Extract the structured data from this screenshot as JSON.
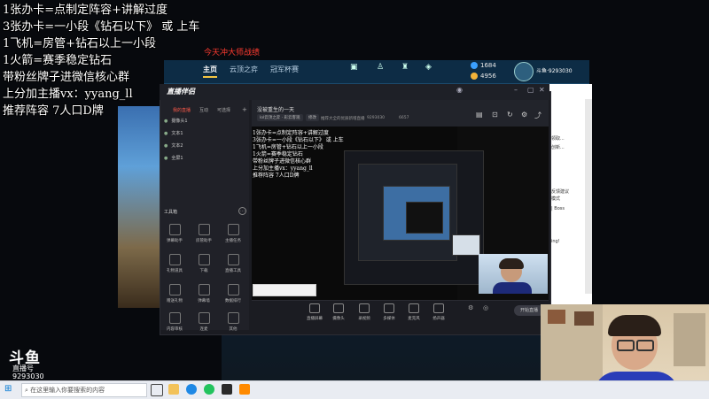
{
  "overlay": {
    "lines": [
      "1张办卡=点制定阵容+讲解过度",
      "3张办卡=一小段《钻石以下》 或 上车",
      "1飞机=房管+钻石以上一小段",
      "1火箭=赛季稳定钻石",
      "带粉丝牌子进微信核心群",
      "上分加主播vx：yyang_ll",
      "推荐阵容  7人口D牌"
    ],
    "red_title": "今天冲大师战绩"
  },
  "game": {
    "tabs": [
      "主页",
      "云顶之弈",
      "冠军杯赛"
    ],
    "active_tab": "主页",
    "currency1": "1684",
    "currency2": "4956",
    "user": "斗鱼·9293030"
  },
  "obs": {
    "app_name": "直播伴侣",
    "left_tabs": [
      "我的直播",
      "互动",
      "可选择"
    ],
    "scenes": [
      "摄像头1",
      "文本1",
      "文本2",
      "全屏1"
    ],
    "tools_title": "工具箱",
    "tools": [
      "弹幕助手",
      "房管助手",
      "主播任务",
      "礼物道具",
      "下载",
      "直播工具",
      "赠送礼物",
      "弹幕墙",
      "数据排行",
      "内容审核",
      "连麦",
      "其他"
    ],
    "preview_title": "没被重生的一天",
    "preview_chips": [
      "lol云顶之弈 · 彩云客观",
      "修改"
    ],
    "preview_sub": "推荐大全的优质新增直播",
    "room_id": "9293030",
    "viewers": "6657",
    "bottom_tools": [
      "直播屏幕",
      "摄像头",
      "录视频",
      "多媒体",
      "麦克风",
      "扬声器"
    ],
    "go_live": "开始直播"
  },
  "mini_text": [
    "1张办卡=点制定阵容+讲解过度",
    "3张办卡=一小段《钻石以下》 或 上车",
    "1飞机=房管+钻石以上一小段",
    "1火箭=赛季稳定钻石",
    "带粉丝牌子进微信核心群",
    "上分加主播vx：yyang_ll",
    "推荐阵容  7人口D牌"
  ],
  "right_window": [
    "领取...",
    "创新...",
    "反馈建议",
    "模式",
    "| Boss",
    "ing!"
  ],
  "watermark": {
    "brand": "斗鱼",
    "sub": "直播号",
    "id": "9293030"
  },
  "taskbar": {
    "search_placeholder": "在这里输入你要搜索的内容"
  },
  "colors": {
    "overlay_text": "#ffffff",
    "red": "#ff3b30",
    "game_header": "#0d2c45",
    "obs_bg": "#1b1c22"
  }
}
